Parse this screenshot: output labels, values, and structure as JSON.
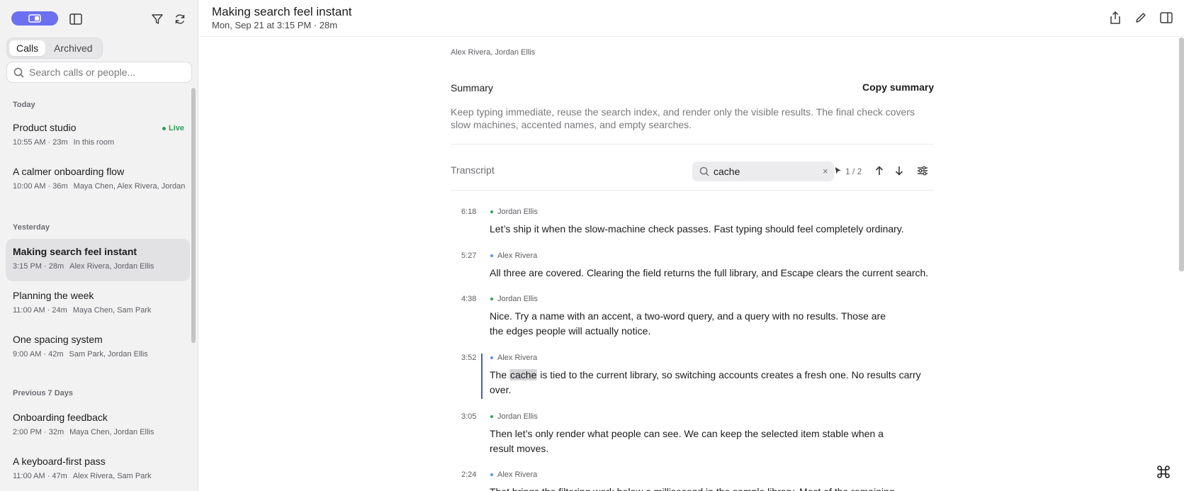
{
  "sidebar": {
    "tabs": [
      {
        "label": "Calls",
        "active": true
      },
      {
        "label": "Archived",
        "active": false
      }
    ],
    "search_placeholder": "Search calls or people...",
    "groups": [
      {
        "title": "Today",
        "items": [
          {
            "title": "Product studio",
            "time": "10:55 AM · 23m",
            "people": "In this room",
            "live": "Live",
            "selected": false
          },
          {
            "title": "A calmer onboarding flow",
            "time": "10:00 AM · 36m",
            "people": "Maya Chen, Alex Rivera, Jordan Ellis",
            "selected": false
          }
        ]
      },
      {
        "title": "Yesterday",
        "items": [
          {
            "title": "Making search feel instant",
            "time": "3:15 PM · 28m",
            "people": "Alex Rivera, Jordan Ellis",
            "selected": true
          },
          {
            "title": "Planning the week",
            "time": "11:00 AM · 24m",
            "people": "Maya Chen, Sam Park",
            "selected": false
          },
          {
            "title": "One spacing system",
            "time": "9:00 AM · 42m",
            "people": "Sam Park, Jordan Ellis",
            "selected": false
          }
        ]
      },
      {
        "title": "Previous 7 Days",
        "items": [
          {
            "title": "Onboarding feedback",
            "time": "2:00 PM · 32m",
            "people": "Maya Chen, Jordan Ellis",
            "selected": false
          },
          {
            "title": "A keyboard-first pass",
            "time": "11:00 AM · 47m",
            "people": "Alex Rivera, Sam Park",
            "selected": false
          }
        ]
      }
    ]
  },
  "header": {
    "title": "Making search feel instant",
    "subtitle": "Mon, Sep 21 at 3:15 PM · 28m"
  },
  "main": {
    "participants": "Alex Rivera, Jordan Ellis",
    "summary_label": "Summary",
    "copy_summary": "Copy summary",
    "summary_text": "Keep typing immediate, reuse the search index, and render only the visible results. The final check covers slow machines, accented names, and empty searches.",
    "transcript_label": "Transcript",
    "transcript_search": {
      "value": "cache",
      "clear": "×",
      "count": "1 / 2"
    },
    "entries": [
      {
        "time": "6:18",
        "speaker": "Jordan Ellis",
        "text": "Let’s ship it when the slow-machine check passes. Fast typing should feel completely ordinary."
      },
      {
        "time": "5:27",
        "speaker": "Alex Rivera",
        "text": "All three are covered. Clearing the field returns the full library, and Escape clears the current search."
      },
      {
        "time": "4:38",
        "speaker": "Jordan Ellis",
        "text": "Nice. Try a name with an accent, a two-word query, and a query with no results. Those are the edges people will actually notice."
      },
      {
        "time": "3:52",
        "speaker": "Alex Rivera",
        "text_before": "The ",
        "highlight": "cache",
        "text_after": " is tied to the current library, so switching accounts creates a fresh one. No results carry over.",
        "active": true
      },
      {
        "time": "3:05",
        "speaker": "Jordan Ellis",
        "text": "Then let’s only render what people can see. We can keep the selected item stable when a result moves."
      },
      {
        "time": "2:24",
        "speaker": "Alex Rivera",
        "text": "That brings the filtering work below a millisecond in the sample library. Most of the remaining"
      }
    ]
  },
  "colors": {
    "accent": "#6b6ff0",
    "live": "#2f9e56",
    "active_bar": "#3b5bd9",
    "speaker_alex": "#5b8cf0",
    "speaker_jordan": "#2f9e56"
  },
  "icons": [
    "record-icon",
    "sidebar-toggle-icon",
    "filter-icon",
    "refresh-icon",
    "search-icon",
    "share-icon",
    "edit-icon",
    "panel-icon",
    "arrow-up-icon",
    "arrow-down-icon",
    "options-icon",
    "command-icon"
  ]
}
